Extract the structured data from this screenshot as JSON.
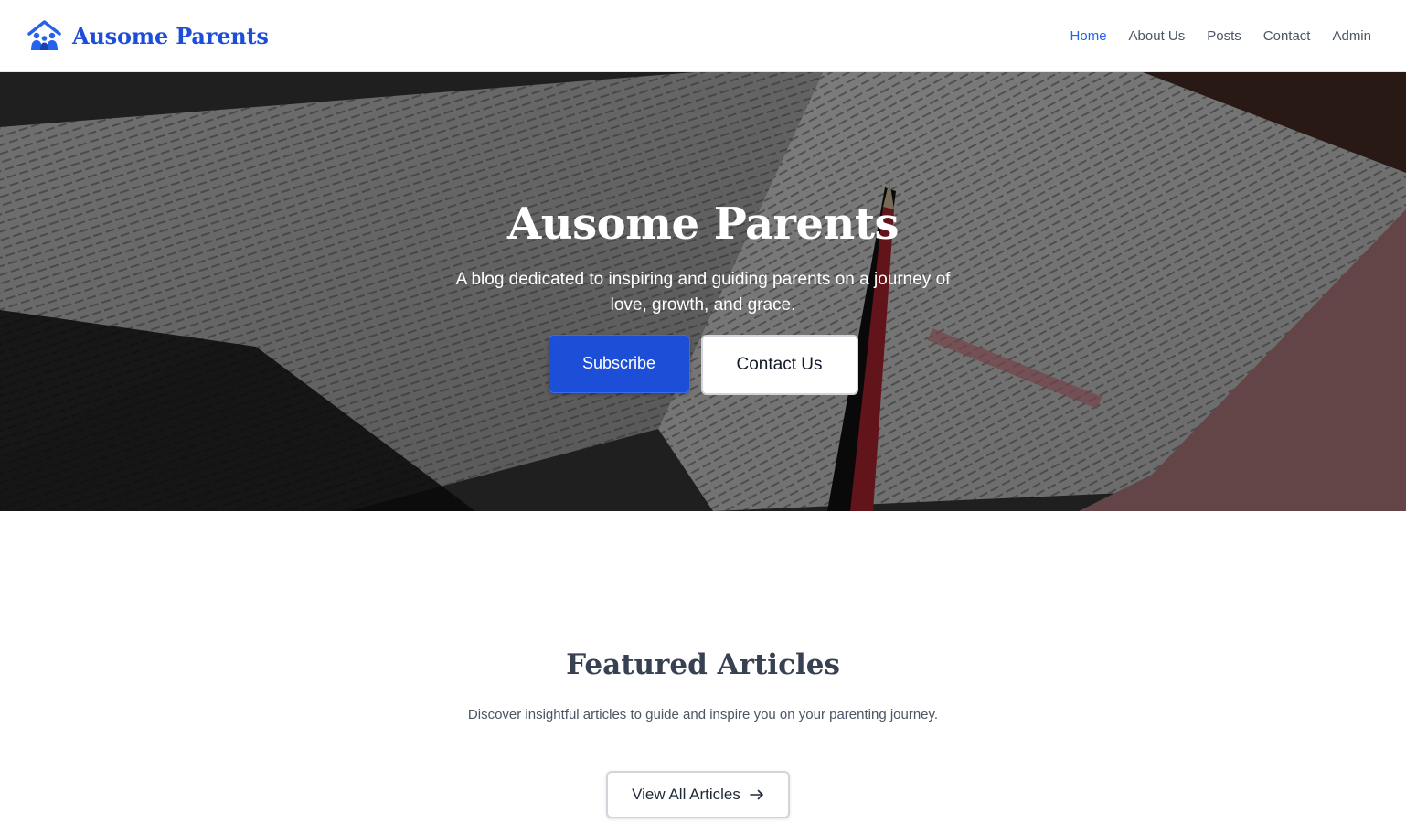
{
  "header": {
    "brand_name": "Ausome Parents",
    "brand_icon": "family-house-icon",
    "nav": [
      {
        "label": "Home",
        "active": true
      },
      {
        "label": "About Us",
        "active": false
      },
      {
        "label": "Posts",
        "active": false
      },
      {
        "label": "Contact",
        "active": false
      },
      {
        "label": "Admin",
        "active": false
      }
    ]
  },
  "hero": {
    "title": "Ausome Parents",
    "subtitle": "A blog dedicated to inspiring and guiding parents on a journey of love, growth, and grace.",
    "primary_button": "Subscribe",
    "secondary_button": "Contact Us",
    "background_image": "open-bible-with-red-pencil"
  },
  "featured": {
    "title": "Featured Articles",
    "description": "Discover insightful articles to guide and inspire you on your parenting journey.",
    "view_all_button": "View All Articles",
    "view_all_icon": "arrow-right-icon"
  },
  "colors": {
    "accent": "#1d4ed8",
    "nav_active": "#2563eb",
    "text": "#374151"
  }
}
